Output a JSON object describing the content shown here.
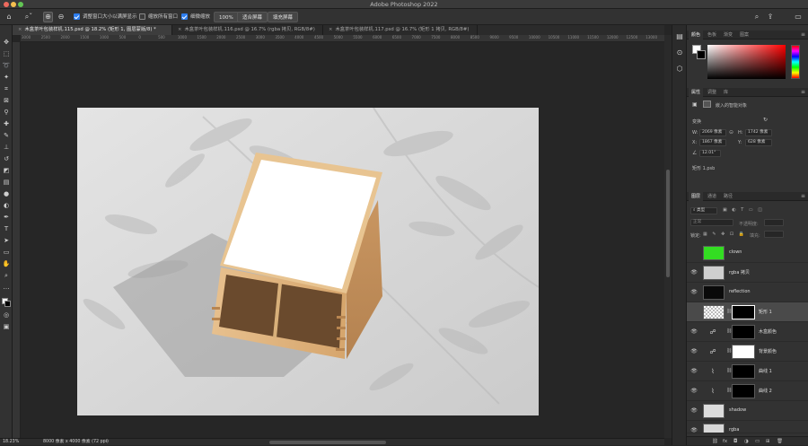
{
  "app": {
    "window_title": "Adobe Photoshop 2022"
  },
  "options_bar": {
    "zoom_percent": "100%",
    "resize_windows_label": "调整窗口大小以满屏显示",
    "resize_windows_checked": true,
    "zoom_all_windows_label": "缩放所有窗口",
    "zoom_all_windows_checked": false,
    "scrubby_zoom_label": "细微缩放",
    "scrubby_zoom_checked": true,
    "fit_screen_label": "适合屏幕",
    "fill_screen_label": "填充屏幕"
  },
  "tabs": [
    {
      "label": "木盒茶叶包装样机.115.psd @ 18.2% (矩形 1, 图层蒙版/8) *",
      "active": true
    },
    {
      "label": "木盒茶叶包装样机.116.psd @ 16.7% (rgba 拷贝, RGB/8#)",
      "active": false
    },
    {
      "label": "木盒茶叶包装样机.117.psd @ 16.7% (矩形 1 拷贝, RGB/8#)",
      "active": false
    }
  ],
  "ruler_top": [
    "3000",
    "2500",
    "2000",
    "1500",
    "1000",
    "500",
    "0",
    "500",
    "1000",
    "1500",
    "2000",
    "2500",
    "3000",
    "3500",
    "4000",
    "4500",
    "5000",
    "5500",
    "6000",
    "6500",
    "7000",
    "7500",
    "8000",
    "8500",
    "9000",
    "9500",
    "10000",
    "10500",
    "11000",
    "11500",
    "12000",
    "12500",
    "13000"
  ],
  "status_bar": {
    "zoom": "18.23%",
    "doc_info": "8000 像素 x 4000 像素 (72 ppi)"
  },
  "color_panel": {
    "tabs": [
      "颜色",
      "色板",
      "渐变",
      "图案"
    ],
    "active_tab": "颜色",
    "foreground": "#ffffff",
    "background": "#000000",
    "hue_color": "#ff0000"
  },
  "properties_panel": {
    "tabs": [
      "属性",
      "调整",
      "库"
    ],
    "active_tab": "属性",
    "kind_label": "嵌入的智能对象",
    "transform_label": "变换",
    "w_label": "W:",
    "w_value": "2069 像素",
    "h_label": "H:",
    "h_value": "1742 像素",
    "x_label": "X:",
    "x_value": "1867 像素",
    "y_label": "Y:",
    "y_value": "628 像素",
    "angle_value": "12.01°",
    "file_name": "矩形 1.psb"
  },
  "layers_panel": {
    "tabs": [
      "图层",
      "通道",
      "路径"
    ],
    "active_tab": "图层",
    "filter_kind": "类型",
    "blend_mode": "正常",
    "blend_mode_placeholder": "正片叠底",
    "opacity_label": "不透明度:",
    "lock_label": "锁定:",
    "fill_label": "填充:",
    "layers": [
      {
        "name": "clown",
        "visible": false,
        "thumb": "#33dd22",
        "kind": "pixel",
        "selected": false
      },
      {
        "name": "rgba 拷贝",
        "visible": true,
        "thumb": "#cfcfcf",
        "kind": "pixel",
        "selected": false
      },
      {
        "name": "reflection",
        "visible": true,
        "thumb": "#0a0a0a",
        "kind": "pixel",
        "selected": false
      },
      {
        "name": "矩形 1",
        "visible": false,
        "thumb": "#ffffff",
        "kind": "smart-mask",
        "selected": true
      },
      {
        "name": "木盒颜色",
        "visible": true,
        "thumb": "",
        "kind": "adjust-mask",
        "selected": false
      },
      {
        "name": "背景颜色",
        "visible": true,
        "thumb": "",
        "kind": "adjust-mask",
        "selected": false
      },
      {
        "name": "曲线 1",
        "visible": true,
        "thumb": "",
        "kind": "curves-mask",
        "selected": false
      },
      {
        "name": "曲线 2",
        "visible": true,
        "thumb": "",
        "kind": "curves-mask",
        "selected": false
      },
      {
        "name": "shadow",
        "visible": true,
        "thumb": "#dcdcdc",
        "kind": "pixel",
        "selected": false
      },
      {
        "name": "rgba",
        "visible": true,
        "thumb": "#d8d8d8",
        "kind": "pixel",
        "selected": false
      }
    ]
  },
  "icons": {
    "home": "home-icon",
    "zoom": "zoom-icon",
    "zoom_in": "zoom-in-icon",
    "zoom_out": "zoom-out-icon",
    "search": "search-icon",
    "share": "share-icon",
    "workspace": "workspace-icon"
  }
}
